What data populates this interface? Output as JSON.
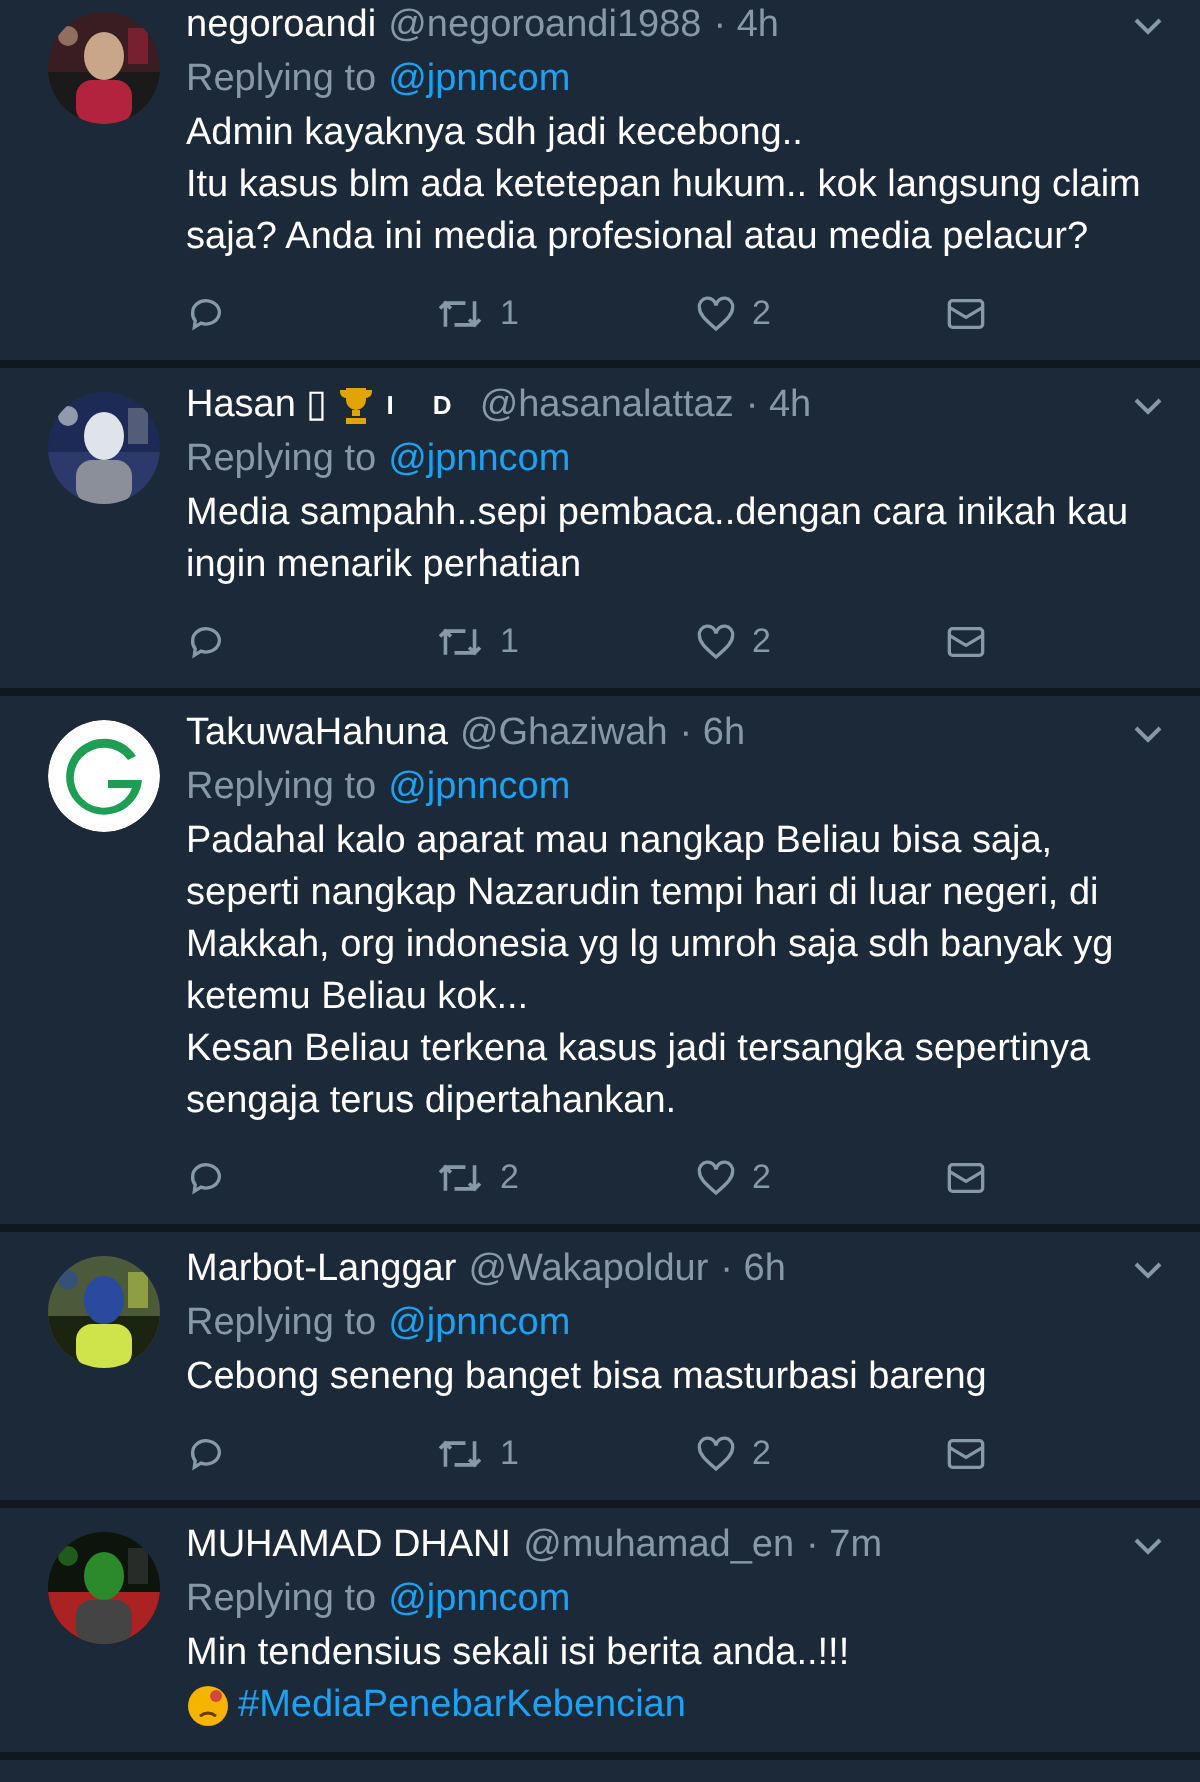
{
  "tweets": [
    {
      "name": "negoroandi",
      "handle": "@negoroandi1988",
      "time": "· 4h",
      "replying_label": "Replying to",
      "replying_to": "@jpnncom",
      "body": "Admin kayaknya sdh jadi kecebong..\nItu kasus blm ada ketetepan hukum.. kok langsung claim saja? Anda ini media profesional atau media pelacur?",
      "avatar_logo": false,
      "retweets": "1",
      "likes": "2"
    },
    {
      "name": "Hasan ▯",
      "trophy": true,
      "name_tag": "I D",
      "handle": "@hasanalattaz",
      "time": "· 4h",
      "replying_label": "Replying to",
      "replying_to": "@jpnncom",
      "body": "Media sampahh..sepi pembaca..dengan cara inikah kau ingin menarik perhatian",
      "avatar_logo": false,
      "retweets": "1",
      "likes": "2"
    },
    {
      "name": "TakuwaHahuna",
      "handle": "@Ghaziwah",
      "time": "· 6h",
      "replying_label": "Replying to",
      "replying_to": "@jpnncom",
      "body": "Padahal kalo aparat mau nangkap Beliau bisa saja, seperti nangkap Nazarudin tempi hari di luar negeri, di Makkah, org indonesia yg lg umroh saja sdh banyak yg ketemu Beliau kok...\nKesan Beliau terkena kasus jadi tersangka sepertinya sengaja terus dipertahankan.",
      "avatar_logo": true,
      "retweets": "2",
      "likes": "2"
    },
    {
      "name": "Marbot-Langgar",
      "handle": "@Wakapoldur",
      "time": "· 6h",
      "replying_label": "Replying to",
      "replying_to": "@jpnncom",
      "body": "Cebong seneng banget bisa masturbasi bareng",
      "avatar_logo": false,
      "retweets": "1",
      "likes": "2"
    },
    {
      "name": "MUHAMAD DHANI",
      "handle": "@muhamad_en",
      "time": "· 7m",
      "replying_label": "Replying to",
      "replying_to": "@jpnncom",
      "body": "Min tendensius sekali isi berita anda..!!!",
      "hashtag_emoji": true,
      "hashtag": "#MediaPenebarKebencian",
      "avatar_logo": false
    }
  ]
}
